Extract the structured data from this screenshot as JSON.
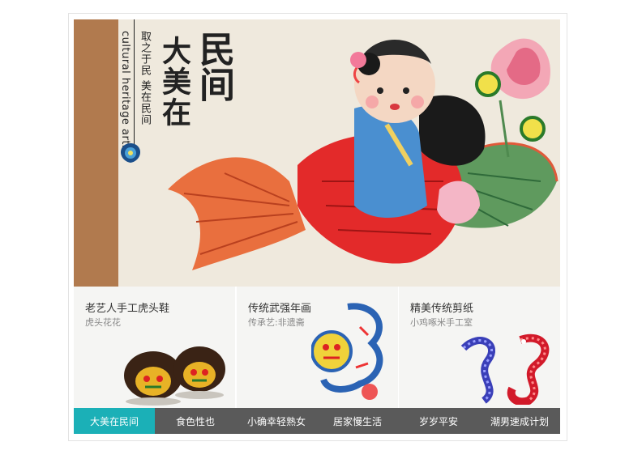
{
  "hero": {
    "english_caption": "cultural heritage arts",
    "tagline": "取之于民 美在民间",
    "headline_small": "大美在",
    "headline_large": "民间"
  },
  "panels": [
    {
      "title": "老艺人手工虎头鞋",
      "subtitle": "虎头花花",
      "image_icon": "tiger-head-shoes"
    },
    {
      "title": "传统武强年画",
      "subtitle": "传承艺:非遗斋",
      "image_icon": "lion-new-year-painting"
    },
    {
      "title": "精美传统剪纸",
      "subtitle": "小鸡啄米手工室",
      "image_icon": "snake-paper-cut"
    }
  ],
  "tabs": [
    {
      "label": "大美在民间",
      "active": true
    },
    {
      "label": "食色性也",
      "active": false
    },
    {
      "label": "小确幸轻熟女",
      "active": false
    },
    {
      "label": "居家慢生活",
      "active": false
    },
    {
      "label": "岁岁平安",
      "active": false
    },
    {
      "label": "潮男速成计划",
      "active": false
    }
  ],
  "colors": {
    "side_strip": "#b17a4e",
    "active_tab": "#1bb0b7",
    "tab_bar": "#5a5a5a",
    "panel_bg": "#f5f5f3"
  }
}
